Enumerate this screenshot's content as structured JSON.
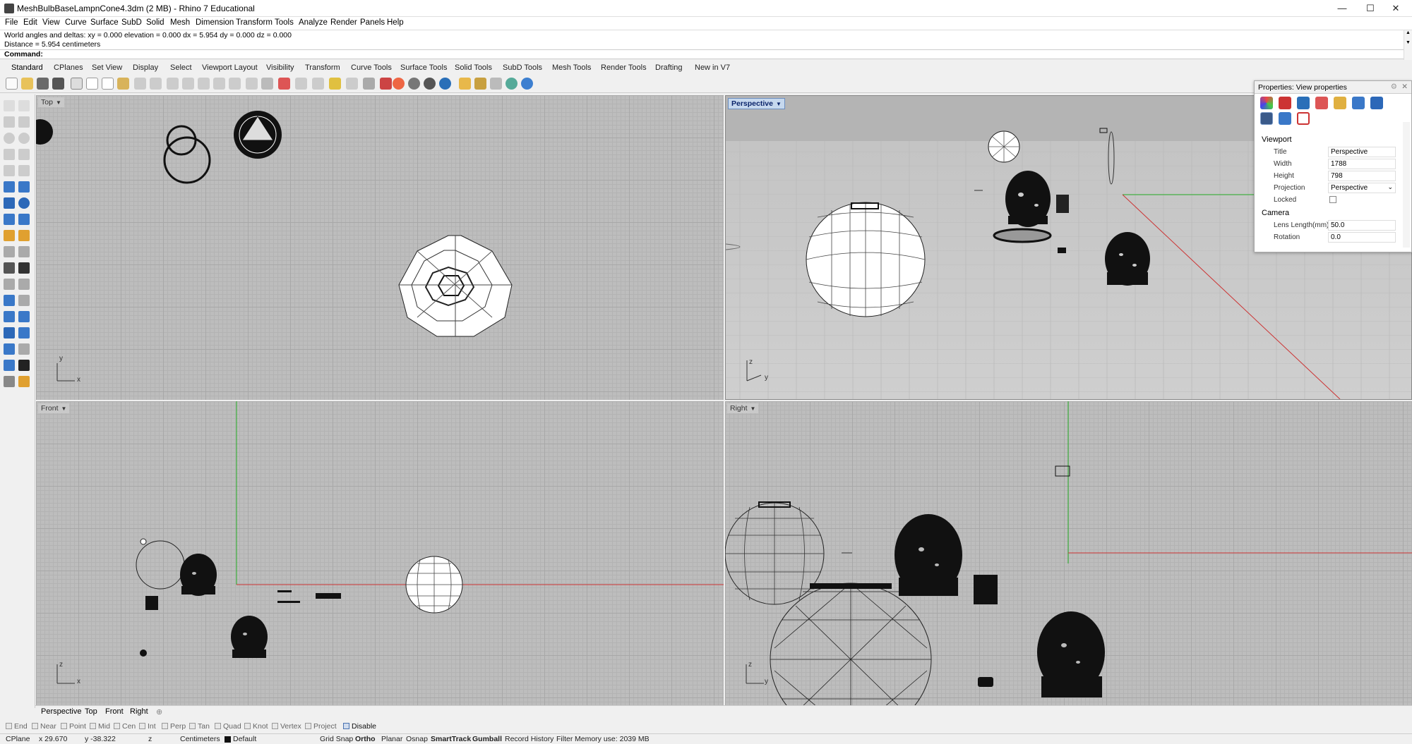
{
  "window": {
    "title": "MeshBulbBaseLampnCone4.3dm (2 MB) - Rhino 7 Educational",
    "controls": [
      "—",
      "☐",
      "✕"
    ]
  },
  "menu": [
    "File",
    "Edit",
    "View",
    "Curve",
    "Surface",
    "SubD",
    "Solid",
    "Mesh",
    "Dimension",
    "Transform",
    "Tools",
    "Analyze",
    "Render",
    "Panels",
    "Help"
  ],
  "command_history": {
    "line1": "World angles and deltas:   xy = 0.000  elevation = 0.000        dx = 5.954  dy = 0.000  dz = 0.000",
    "line2": "Distance = 5.954 centimeters",
    "prompt": "Command:"
  },
  "toolbar_tabs": [
    "Standard",
    "CPlanes",
    "Set View",
    "Display",
    "Select",
    "Viewport Layout",
    "Visibility",
    "Transform",
    "Curve Tools",
    "Surface Tools",
    "Solid Tools",
    "SubD Tools",
    "Mesh Tools",
    "Render Tools",
    "Drafting",
    "New in V7"
  ],
  "viewports": {
    "top": {
      "label": "Top",
      "axis_y": "y",
      "axis_x": "x"
    },
    "perspective": {
      "label": "Perspective",
      "axis_y": "z",
      "axis_x": "y"
    },
    "front": {
      "label": "Front",
      "axis_y": "z",
      "axis_x": "x"
    },
    "right": {
      "label": "Right",
      "axis_y": "z",
      "axis_x": "y"
    }
  },
  "viewport_tabs": [
    "Perspective",
    "Top",
    "Front",
    "Right"
  ],
  "osnaps": [
    "End",
    "Near",
    "Point",
    "Mid",
    "Cen",
    "Int",
    "Perp",
    "Tan",
    "Quad",
    "Knot",
    "Vertex",
    "Project",
    "Disable"
  ],
  "status": {
    "cplane": "CPlane",
    "x": "x 29.670",
    "y": "y -38.322",
    "z": "z",
    "units": "Centimeters",
    "layer": "Default",
    "grid_snap": "Grid Snap",
    "ortho": "Ortho",
    "planar": "Planar",
    "osnap": "Osnap",
    "smarttrack": "SmartTrack",
    "gumball": "Gumball",
    "record_history": "Record History",
    "filter": "Filter",
    "memory": "Memory use: 2039 MB"
  },
  "properties": {
    "header": "Properties: View properties",
    "section_viewport": "Viewport",
    "title_label": "Title",
    "title_value": "Perspective",
    "width_label": "Width",
    "width_value": "1788",
    "height_label": "Height",
    "height_value": "798",
    "projection_label": "Projection",
    "projection_value": "Perspective",
    "locked_label": "Locked",
    "section_camera": "Camera",
    "lens_label": "Lens Length(mm)",
    "lens_value": "50.0",
    "rotation_label": "Rotation",
    "rotation_value": "0.0"
  }
}
